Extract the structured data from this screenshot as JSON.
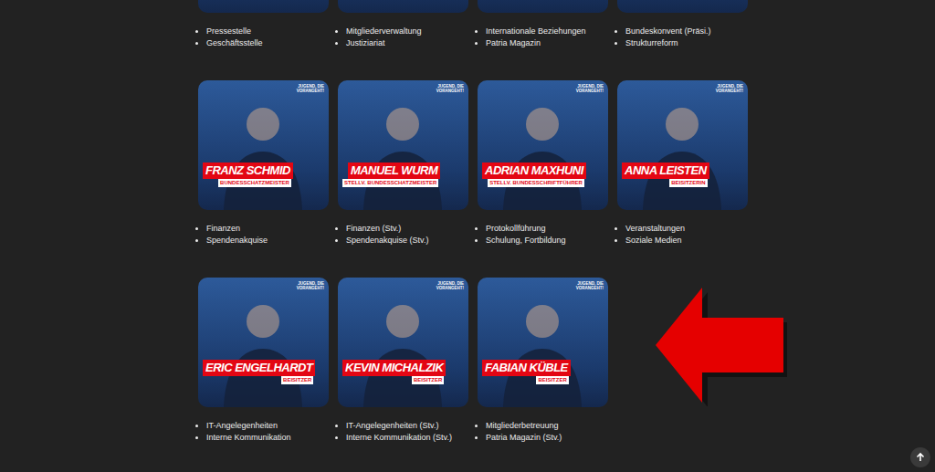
{
  "card_logo": "JUGEND, DIE VORANGEHT!",
  "rows": [
    {
      "members": [
        {
          "kind": "cut",
          "duties": [
            "Pressestelle",
            "Geschäftsstelle"
          ]
        },
        {
          "kind": "cut",
          "duties": [
            "Mitgliederverwaltung",
            "Justiziariat"
          ]
        },
        {
          "kind": "cut",
          "duties": [
            "Internationale Beziehungen",
            "Patria Magazin"
          ]
        },
        {
          "kind": "cut",
          "duties": [
            "Bundeskonvent (Präsi.)",
            "Strukturreform"
          ]
        }
      ]
    },
    {
      "members": [
        {
          "kind": "full",
          "name": "FRANZ SCHMID",
          "role": "BUNDESSCHATZMEISTER",
          "duties": [
            "Finanzen",
            "Spendenakquise"
          ]
        },
        {
          "kind": "full",
          "name": "MANUEL WURM",
          "role": "STELLV. BUNDESSCHATZMEISTER",
          "duties": [
            "Finanzen (Stv.)",
            "Spendenakquise (Stv.)"
          ]
        },
        {
          "kind": "full",
          "name": "ADRIAN MAXHUNI",
          "role": "STELLV. BUNDESSCHRIFTFÜHRER",
          "duties": [
            "Protokollführung",
            "Schulung, Fortbildung"
          ]
        },
        {
          "kind": "full",
          "name": "ANNA LEISTEN",
          "role": "BEISITZERIN",
          "duties": [
            "Veranstaltungen",
            "Soziale Medien"
          ]
        }
      ]
    },
    {
      "members": [
        {
          "kind": "full",
          "name": "ERIC ENGELHARDT",
          "role": "BEISITZER",
          "duties": [
            "IT-Angelegenheiten",
            "Interne Kommunikation"
          ]
        },
        {
          "kind": "full",
          "name": "KEVIN MICHALZIK",
          "role": "BEISITZER",
          "duties": [
            "IT-Angelegenheiten (Stv.)",
            "Interne Kommunikation (Stv.)"
          ]
        },
        {
          "kind": "full",
          "name": "FABIAN KÜBLE",
          "role": "BEISITZER",
          "duties": [
            "Mitgliederbetreuung",
            "Patria Magazin (Stv.)"
          ]
        }
      ]
    }
  ]
}
